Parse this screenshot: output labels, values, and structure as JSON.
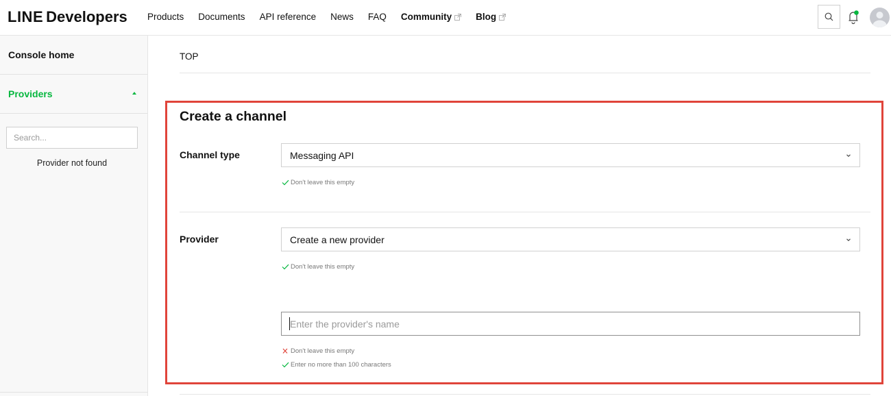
{
  "header": {
    "logo_brand": "LINE",
    "logo_product": "Developers",
    "nav": [
      {
        "label": "Products"
      },
      {
        "label": "Documents"
      },
      {
        "label": "API reference"
      },
      {
        "label": "News"
      },
      {
        "label": "FAQ"
      },
      {
        "label": "Community"
      },
      {
        "label": "Blog"
      }
    ]
  },
  "sidebar": {
    "home_label": "Console home",
    "providers_label": "Providers",
    "search_placeholder": "Search...",
    "empty_text": "Provider not found"
  },
  "breadcrumb": "TOP",
  "form": {
    "title": "Create a channel",
    "channel_type": {
      "label": "Channel type",
      "value": "Messaging API",
      "hint": "Don't leave this empty"
    },
    "provider": {
      "label": "Provider",
      "value": "Create a new provider",
      "hint": "Don't leave this empty"
    },
    "provider_name": {
      "placeholder": "Enter the provider's name",
      "error_hint": "Don't leave this empty",
      "length_hint": "Enter no more than 100 characters"
    }
  },
  "colors": {
    "accent_green": "#06b73f",
    "highlight_red": "#e0443a",
    "error_red": "#e0443a"
  }
}
